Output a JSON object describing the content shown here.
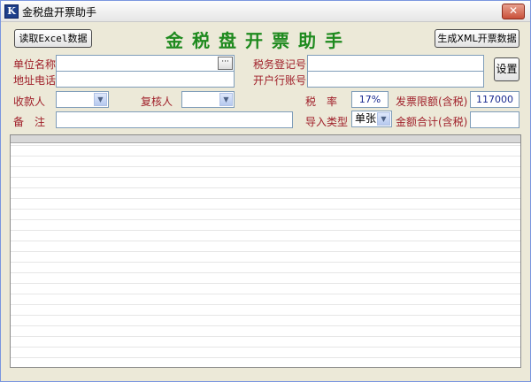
{
  "window": {
    "title": "金税盘开票助手",
    "icon_letter": "K",
    "close_glyph": "✕"
  },
  "header": {
    "read_excel_label": "读取Excel数据",
    "app_title": "金税盘开票助手",
    "generate_xml_label": "生成XML开票数据"
  },
  "form": {
    "unit_name_label": "单位名称",
    "address_phone_label": "地址电话",
    "tax_reg_label": "税务登记号",
    "bank_account_label": "开户行账号",
    "settings_label": "设置",
    "payee_label": "收款人",
    "reviewer_label": "复核人",
    "tax_rate_label": "税　率",
    "tax_rate_value": "17%",
    "invoice_limit_label": "发票限额(含税)",
    "invoice_limit_value": "117000",
    "remark_label": "备　注",
    "import_type_label": "导入类型",
    "import_type_value": "单张",
    "amount_total_label": "金额合计(含税)",
    "dots_glyph": "···",
    "arrow_glyph": "▼"
  }
}
